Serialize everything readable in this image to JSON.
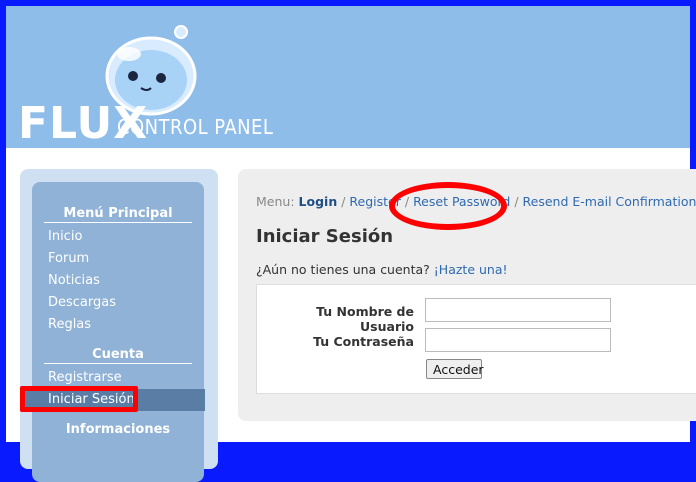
{
  "header": {
    "logo_main": "FLUX",
    "logo_sub": "CONTROL PANEL",
    "mascot_icon": "slime-mascot-icon"
  },
  "sidebar": {
    "sections": [
      {
        "heading": "Menú Principal",
        "items": [
          "Inicio",
          "Forum",
          "Noticias",
          "Descargas",
          "Reglas"
        ]
      },
      {
        "heading": "Cuenta",
        "items": [
          "Registrarse",
          "Iniciar Sesión"
        ]
      },
      {
        "heading": "Informaciones",
        "items": []
      }
    ],
    "active_item": "Iniciar Sesión"
  },
  "main": {
    "menu_prefix": "Menu:",
    "menu_links": [
      "Login",
      "Register",
      "Reset Password",
      "Resend E-mail Confirmation"
    ],
    "menu_active": "Login",
    "title": "Iniciar Sesión",
    "signup_text": "¿Aún no tienes una cuenta?",
    "signup_link": "¡Hazte una!",
    "form": {
      "username_label": "Tu Nombre de Usuario",
      "password_label": "Tu Contraseña",
      "username_value": "",
      "password_value": "",
      "submit_label": "Acceder"
    }
  },
  "colors": {
    "outer_border": "#0a1aff",
    "header_bg": "#8fbde9",
    "sidebar_bg": "#8fb2d6",
    "highlight": "#ff0000",
    "link": "#2f6aaf"
  }
}
